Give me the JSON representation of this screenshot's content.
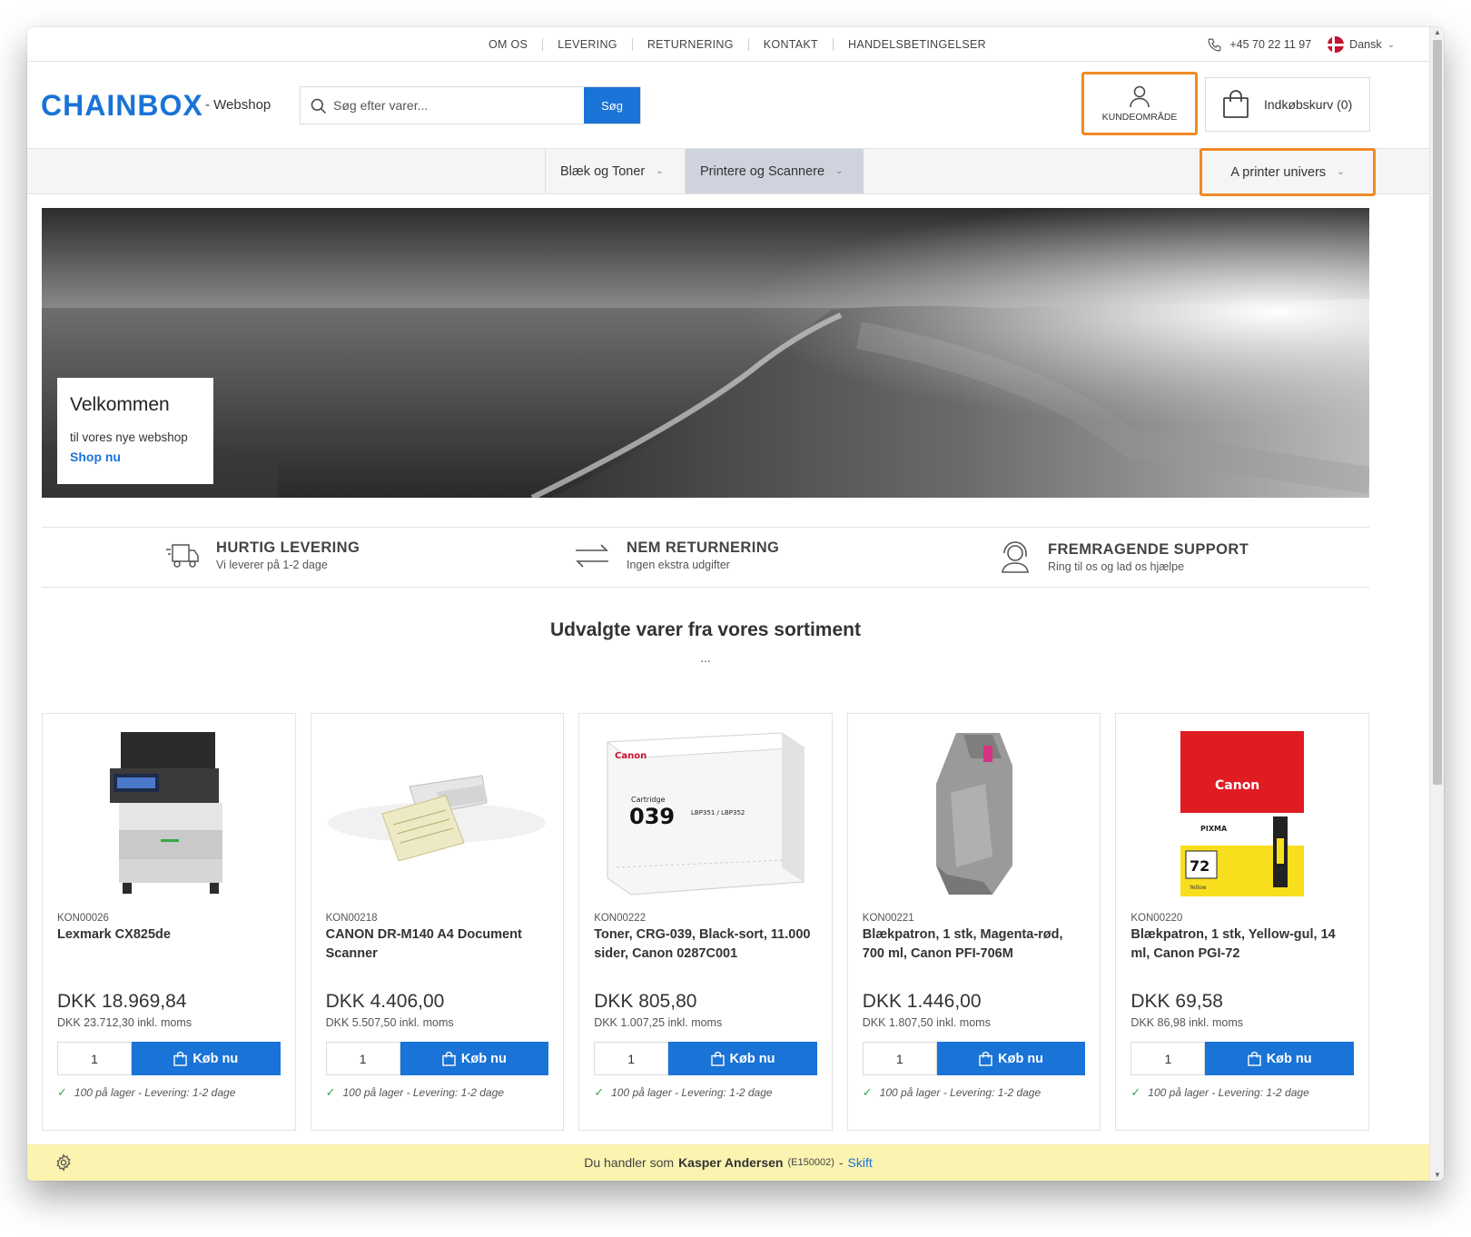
{
  "topnav": {
    "links": [
      "OM OS",
      "LEVERING",
      "RETURNERING",
      "KONTAKT",
      "HANDELSBETINGELSER"
    ],
    "phone": "+45 70 22 11 97",
    "language": "Dansk"
  },
  "header": {
    "logo": "CHAINBOX",
    "logo_sub": "- Webshop",
    "search_placeholder": "Søg efter varer...",
    "search_button": "Søg",
    "customer_area": "KUNDEOMRÅDE",
    "cart": "Indkøbskurv (0)"
  },
  "categories": [
    "Blæk og Toner",
    "Printere og Scannere",
    "A printer univers"
  ],
  "hero": {
    "title": "Velkommen",
    "text": "til vores nye webshop",
    "link": "Shop nu"
  },
  "usps": [
    {
      "title": "HURTIG LEVERING",
      "sub": "Vi leverer på 1-2 dage",
      "icon": "truck-icon"
    },
    {
      "title": "NEM RETURNERING",
      "sub": "Ingen ekstra udgifter",
      "icon": "exchange-arrows-icon"
    },
    {
      "title": "FREMRAGENDE SUPPORT",
      "sub": "Ring til os og lad os hjælpe",
      "icon": "support-headset-icon"
    }
  ],
  "section": {
    "title": "Udvalgte varer fra vores sortiment",
    "dots": "..."
  },
  "products": [
    {
      "sku": "KON00026",
      "name": "Lexmark CX825de",
      "price": "DKK 18.969,84",
      "price_inkl": "DKK 23.712,30 inkl. moms",
      "qty": "1",
      "buy": "Køb nu",
      "stock": "100 på lager - Levering: 1-2 dage"
    },
    {
      "sku": "KON00218",
      "name": "CANON DR-M140 A4 Document Scanner",
      "price": "DKK 4.406,00",
      "price_inkl": "DKK 5.507,50 inkl. moms",
      "qty": "1",
      "buy": "Køb nu",
      "stock": "100 på lager - Levering: 1-2 dage"
    },
    {
      "sku": "KON00222",
      "name": "Toner, CRG-039, Black-sort, 11.000 sider, Canon 0287C001",
      "price": "DKK 805,80",
      "price_inkl": "DKK 1.007,25 inkl. moms",
      "qty": "1",
      "buy": "Køb nu",
      "stock": "100 på lager - Levering: 1-2 dage"
    },
    {
      "sku": "KON00221",
      "name": "Blækpatron, 1 stk, Magenta-rød, 700 ml, Canon PFI-706M",
      "price": "DKK 1.446,00",
      "price_inkl": "DKK 1.807,50 inkl. moms",
      "qty": "1",
      "buy": "Køb nu",
      "stock": "100 på lager - Levering: 1-2 dage"
    },
    {
      "sku": "KON00220",
      "name": "Blækpatron, 1 stk, Yellow-gul, 14 ml, Canon PGI-72",
      "price": "DKK 69,58",
      "price_inkl": "DKK 86,98 inkl. moms",
      "qty": "1",
      "buy": "Køb nu",
      "stock": "100 på lager - Levering: 1-2 dage"
    }
  ],
  "product_images": {
    "toner_brand": "Canon",
    "toner_label": "Cartridge",
    "toner_number": "039",
    "toner_model": "LBP351 / LBP352",
    "ink_brand": "Canon",
    "ink_series": "PIXMA",
    "ink_number": "72",
    "ink_color": "Yellow"
  },
  "footer": {
    "prefix": "Du handler som",
    "user": "Kasper Andersen",
    "code": "(E150002)",
    "separator": "-",
    "switch": "Skift"
  },
  "colors": {
    "accent": "#1a73d6",
    "highlight": "#f08a24",
    "footer_bg": "#fbf3b0",
    "active_category": "#ced3dd"
  }
}
